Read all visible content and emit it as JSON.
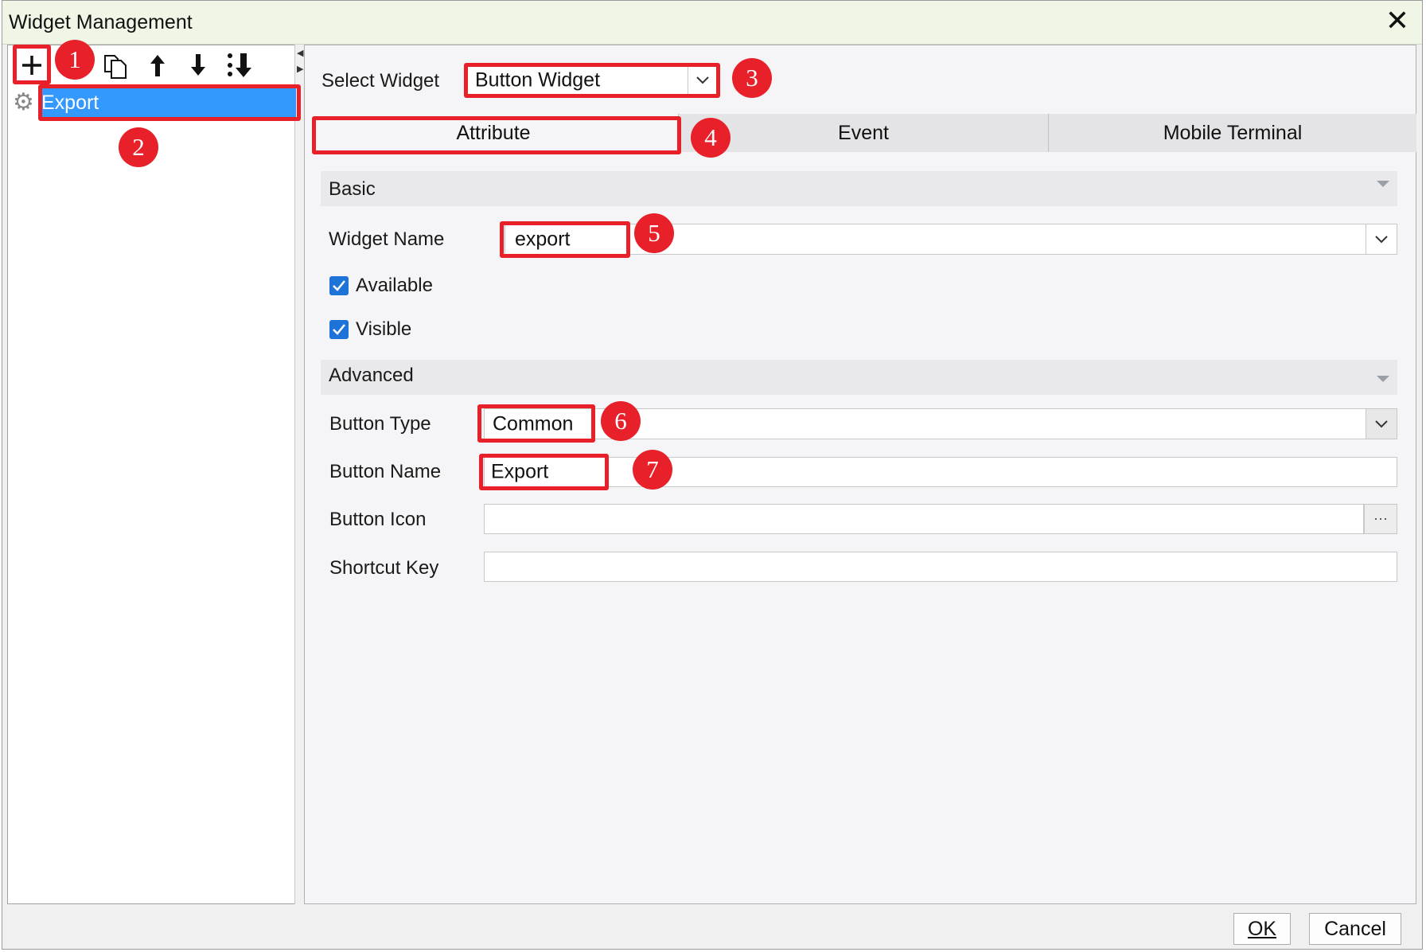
{
  "window": {
    "title": "Widget Management"
  },
  "toolbar": {
    "items": [
      {
        "icon": "plus-icon"
      },
      {
        "icon": "copy-icon"
      },
      {
        "icon": "arrow-up-icon"
      },
      {
        "icon": "arrow-down-icon"
      },
      {
        "icon": "sort-icon"
      }
    ]
  },
  "tree": {
    "items": [
      {
        "label": "Export",
        "icon": "gear-icon",
        "selected": true
      }
    ]
  },
  "select_widget": {
    "label": "Select Widget",
    "value": "Button Widget"
  },
  "tabs": [
    {
      "label": "Attribute",
      "active": true
    },
    {
      "label": "Event",
      "active": false
    },
    {
      "label": "Mobile Terminal",
      "active": false
    }
  ],
  "basic": {
    "title": "Basic",
    "widget_name_label": "Widget Name",
    "widget_name_value": "export",
    "available_label": "Available",
    "available_checked": true,
    "visible_label": "Visible",
    "visible_checked": true
  },
  "advanced": {
    "title": "Advanced",
    "button_type_label": "Button Type",
    "button_type_value": "Common",
    "button_name_label": "Button Name",
    "button_name_value": "Export",
    "button_icon_label": "Button Icon",
    "button_icon_value": "",
    "shortcut_key_label": "Shortcut Key",
    "shortcut_key_value": ""
  },
  "annotations": [
    "1",
    "2",
    "3",
    "4",
    "5",
    "6",
    "7"
  ],
  "footer": {
    "ok": "OK",
    "cancel": "Cancel"
  },
  "colors": {
    "annotation_red": "#e8202a",
    "selection_blue": "#3399ff",
    "checkbox_blue": "#1e73d8"
  }
}
